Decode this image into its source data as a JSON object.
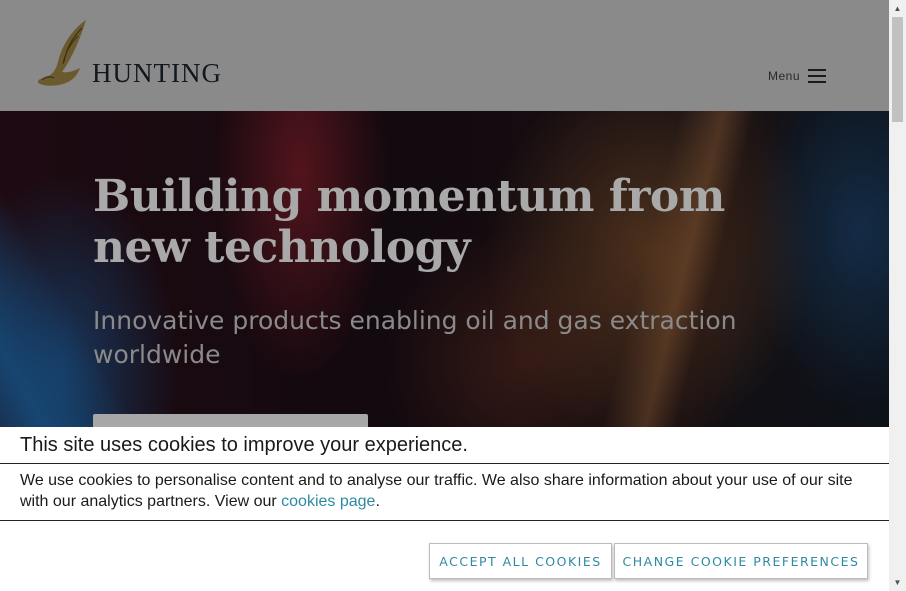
{
  "header": {
    "logo_text": "HUNTING",
    "menu_label": "Menu",
    "menu_icon": "hamburger-icon",
    "logo_icon": "wing-logo-icon"
  },
  "hero": {
    "title": "Building momentum from new technology",
    "subtitle": "Innovative products enabling oil and gas extraction worldwide"
  },
  "cookie_banner": {
    "title": "This site uses cookies to improve your experience.",
    "body_text": "We use cookies to personalise content and to analyse our traffic. We also share information about your use of our site with our analytics partners. View our ",
    "link_text": "cookies page",
    "body_suffix": ".",
    "accept_label": "ACCEPT ALL COOKIES",
    "preferences_label": "CHANGE COOKIE PREFERENCES"
  },
  "colors": {
    "header_bg": "#8a8a8a",
    "accent": "#2e8aa3",
    "logo_gold": "#6b5a2e",
    "logo_navy": "#101820"
  }
}
